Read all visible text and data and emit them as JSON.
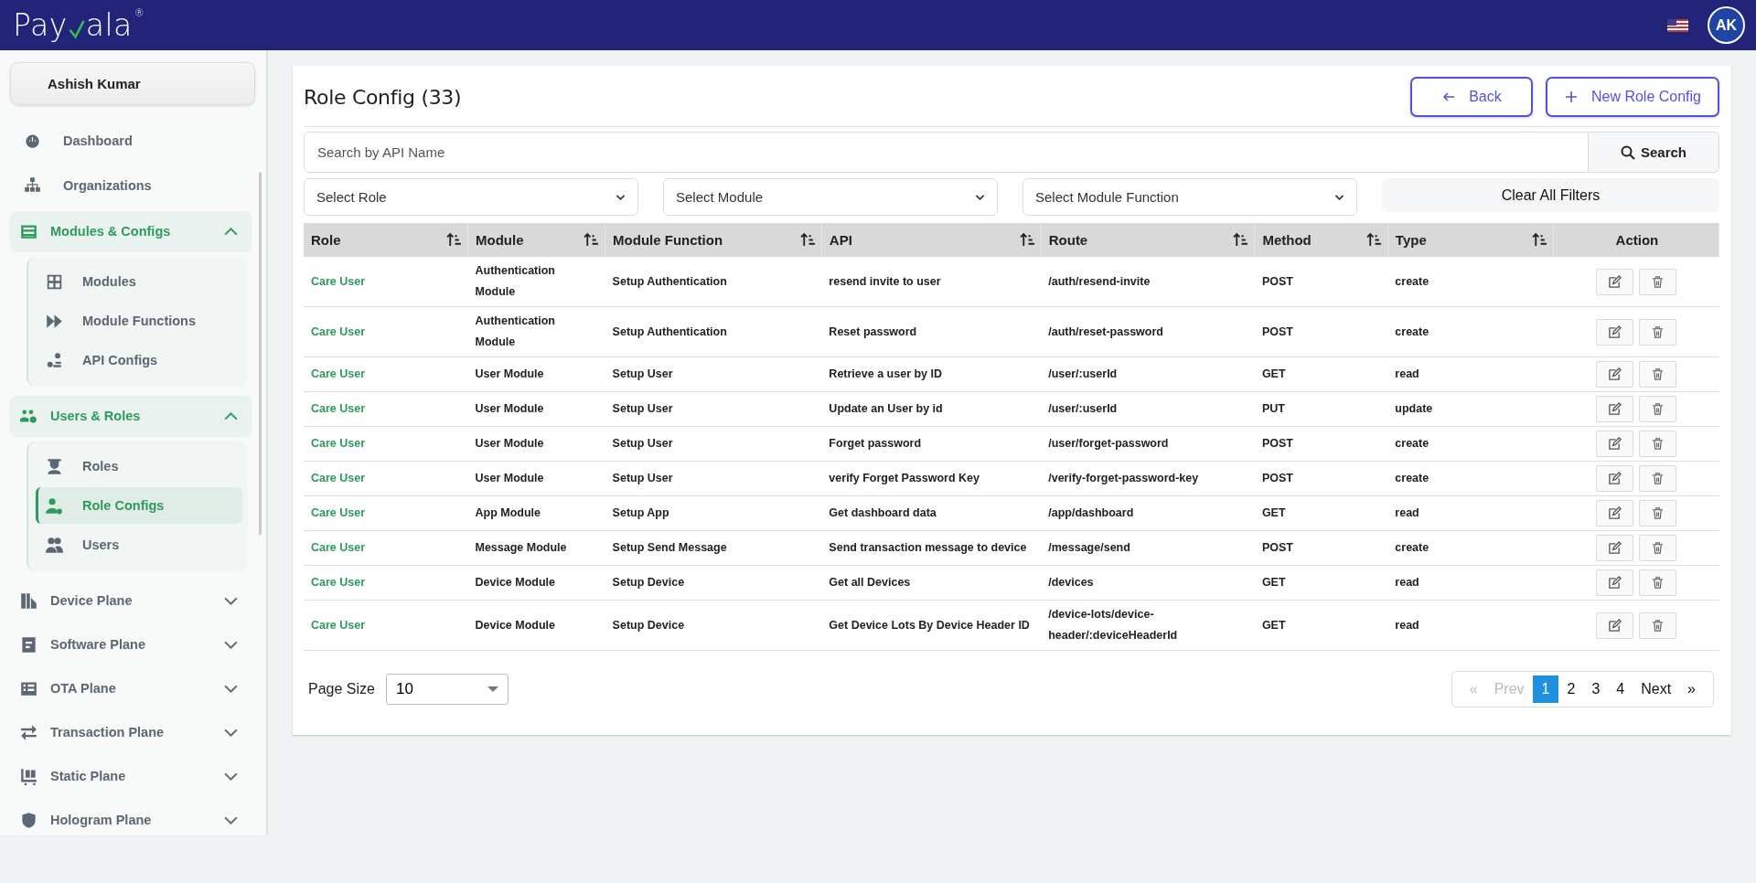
{
  "header": {
    "logo": {
      "before": "Pay",
      "after": "ala",
      "mark": "®"
    },
    "avatar": "AK"
  },
  "sidebar": {
    "user": "Ashish Kumar",
    "items": [
      {
        "kind": "link",
        "label": "Dashboard"
      },
      {
        "kind": "link",
        "label": "Organizations"
      },
      {
        "kind": "group",
        "label": "Modules & Configs",
        "expanded": true,
        "children": [
          {
            "label": "Modules",
            "selected": false
          },
          {
            "label": "Module Functions",
            "selected": false
          },
          {
            "label": "API Configs",
            "selected": false
          }
        ]
      },
      {
        "kind": "group",
        "label": "Users & Roles",
        "expanded": true,
        "children": [
          {
            "label": "Roles",
            "selected": false
          },
          {
            "label": "Role Configs",
            "selected": true
          },
          {
            "label": "Users",
            "selected": false
          }
        ]
      },
      {
        "kind": "group",
        "label": "Device Plane",
        "expanded": false
      },
      {
        "kind": "group",
        "label": "Software Plane",
        "expanded": false
      },
      {
        "kind": "group",
        "label": "OTA Plane",
        "expanded": false
      },
      {
        "kind": "group",
        "label": "Transaction Plane",
        "expanded": false
      },
      {
        "kind": "group",
        "label": "Static Plane",
        "expanded": false
      },
      {
        "kind": "group",
        "label": "Hologram Plane",
        "expanded": false
      }
    ]
  },
  "page": {
    "title": "Role Config (33)",
    "buttons": [
      {
        "kind": "back",
        "label": "Back"
      },
      {
        "kind": "new",
        "label": "New Role Config"
      }
    ],
    "search": {
      "placeholder": "Search by API Name",
      "button": "Search"
    },
    "filters": [
      {
        "placeholder": "Select Role"
      },
      {
        "placeholder": "Select Module"
      },
      {
        "placeholder": "Select Module Function"
      }
    ],
    "clear_button": "Clear All Filters"
  },
  "table": {
    "columns": [
      {
        "label": "Role",
        "sortable": true
      },
      {
        "label": "Module",
        "sortable": true
      },
      {
        "label": "Module Function",
        "sortable": true
      },
      {
        "label": "API",
        "sortable": true
      },
      {
        "label": "Route",
        "sortable": true
      },
      {
        "label": "Method",
        "sortable": true
      },
      {
        "label": "Type",
        "sortable": true
      },
      {
        "label": "Action",
        "sortable": false
      }
    ],
    "rows": [
      {
        "role": "Care User",
        "module": "Authentication Module",
        "function": "Setup Authentication",
        "api": "resend invite to user",
        "route": "/auth/resend-invite",
        "method": "POST",
        "type": "create"
      },
      {
        "role": "Care User",
        "module": "Authentication Module",
        "function": "Setup Authentication",
        "api": "Reset password",
        "route": "/auth/reset-password",
        "method": "POST",
        "type": "create"
      },
      {
        "role": "Care User",
        "module": "User Module",
        "function": "Setup User",
        "api": "Retrieve a user by ID",
        "route": "/user/:userId",
        "method": "GET",
        "type": "read"
      },
      {
        "role": "Care User",
        "module": "User Module",
        "function": "Setup User",
        "api": "Update an User by id",
        "route": "/user/:userId",
        "method": "PUT",
        "type": "update"
      },
      {
        "role": "Care User",
        "module": "User Module",
        "function": "Setup User",
        "api": "Forget password",
        "route": "/user/forget-password",
        "method": "POST",
        "type": "create"
      },
      {
        "role": "Care User",
        "module": "User Module",
        "function": "Setup User",
        "api": "verify Forget Password Key",
        "route": "/verify-forget-password-key",
        "method": "POST",
        "type": "create"
      },
      {
        "role": "Care User",
        "module": "App Module",
        "function": "Setup App",
        "api": "Get dashboard data",
        "route": "/app/dashboard",
        "method": "GET",
        "type": "read"
      },
      {
        "role": "Care User",
        "module": "Message Module",
        "function": "Setup Send Message",
        "api": "Send transaction message to device",
        "route": "/message/send",
        "method": "POST",
        "type": "create"
      },
      {
        "role": "Care User",
        "module": "Device Module",
        "function": "Setup Device",
        "api": "Get all Devices",
        "route": "/devices",
        "method": "GET",
        "type": "read"
      },
      {
        "role": "Care User",
        "module": "Device Module",
        "function": "Setup Device",
        "api": "Get Device Lots By Device Header ID",
        "route": "/device-lots/device-header/:deviceHeaderId",
        "method": "GET",
        "type": "read"
      }
    ]
  },
  "footer": {
    "page_size_label": "Page Size",
    "page_size": "10",
    "pagination": {
      "first": {
        "label": "«",
        "disabled": true
      },
      "prev": {
        "label": "Prev",
        "disabled": true
      },
      "pages": [
        {
          "label": "1",
          "selected": true
        },
        {
          "label": "2",
          "selected": false
        },
        {
          "label": "3",
          "selected": false
        },
        {
          "label": "4",
          "selected": false
        }
      ],
      "next": {
        "label": "Next",
        "disabled": false
      },
      "last": {
        "label": "»",
        "disabled": false
      }
    }
  }
}
